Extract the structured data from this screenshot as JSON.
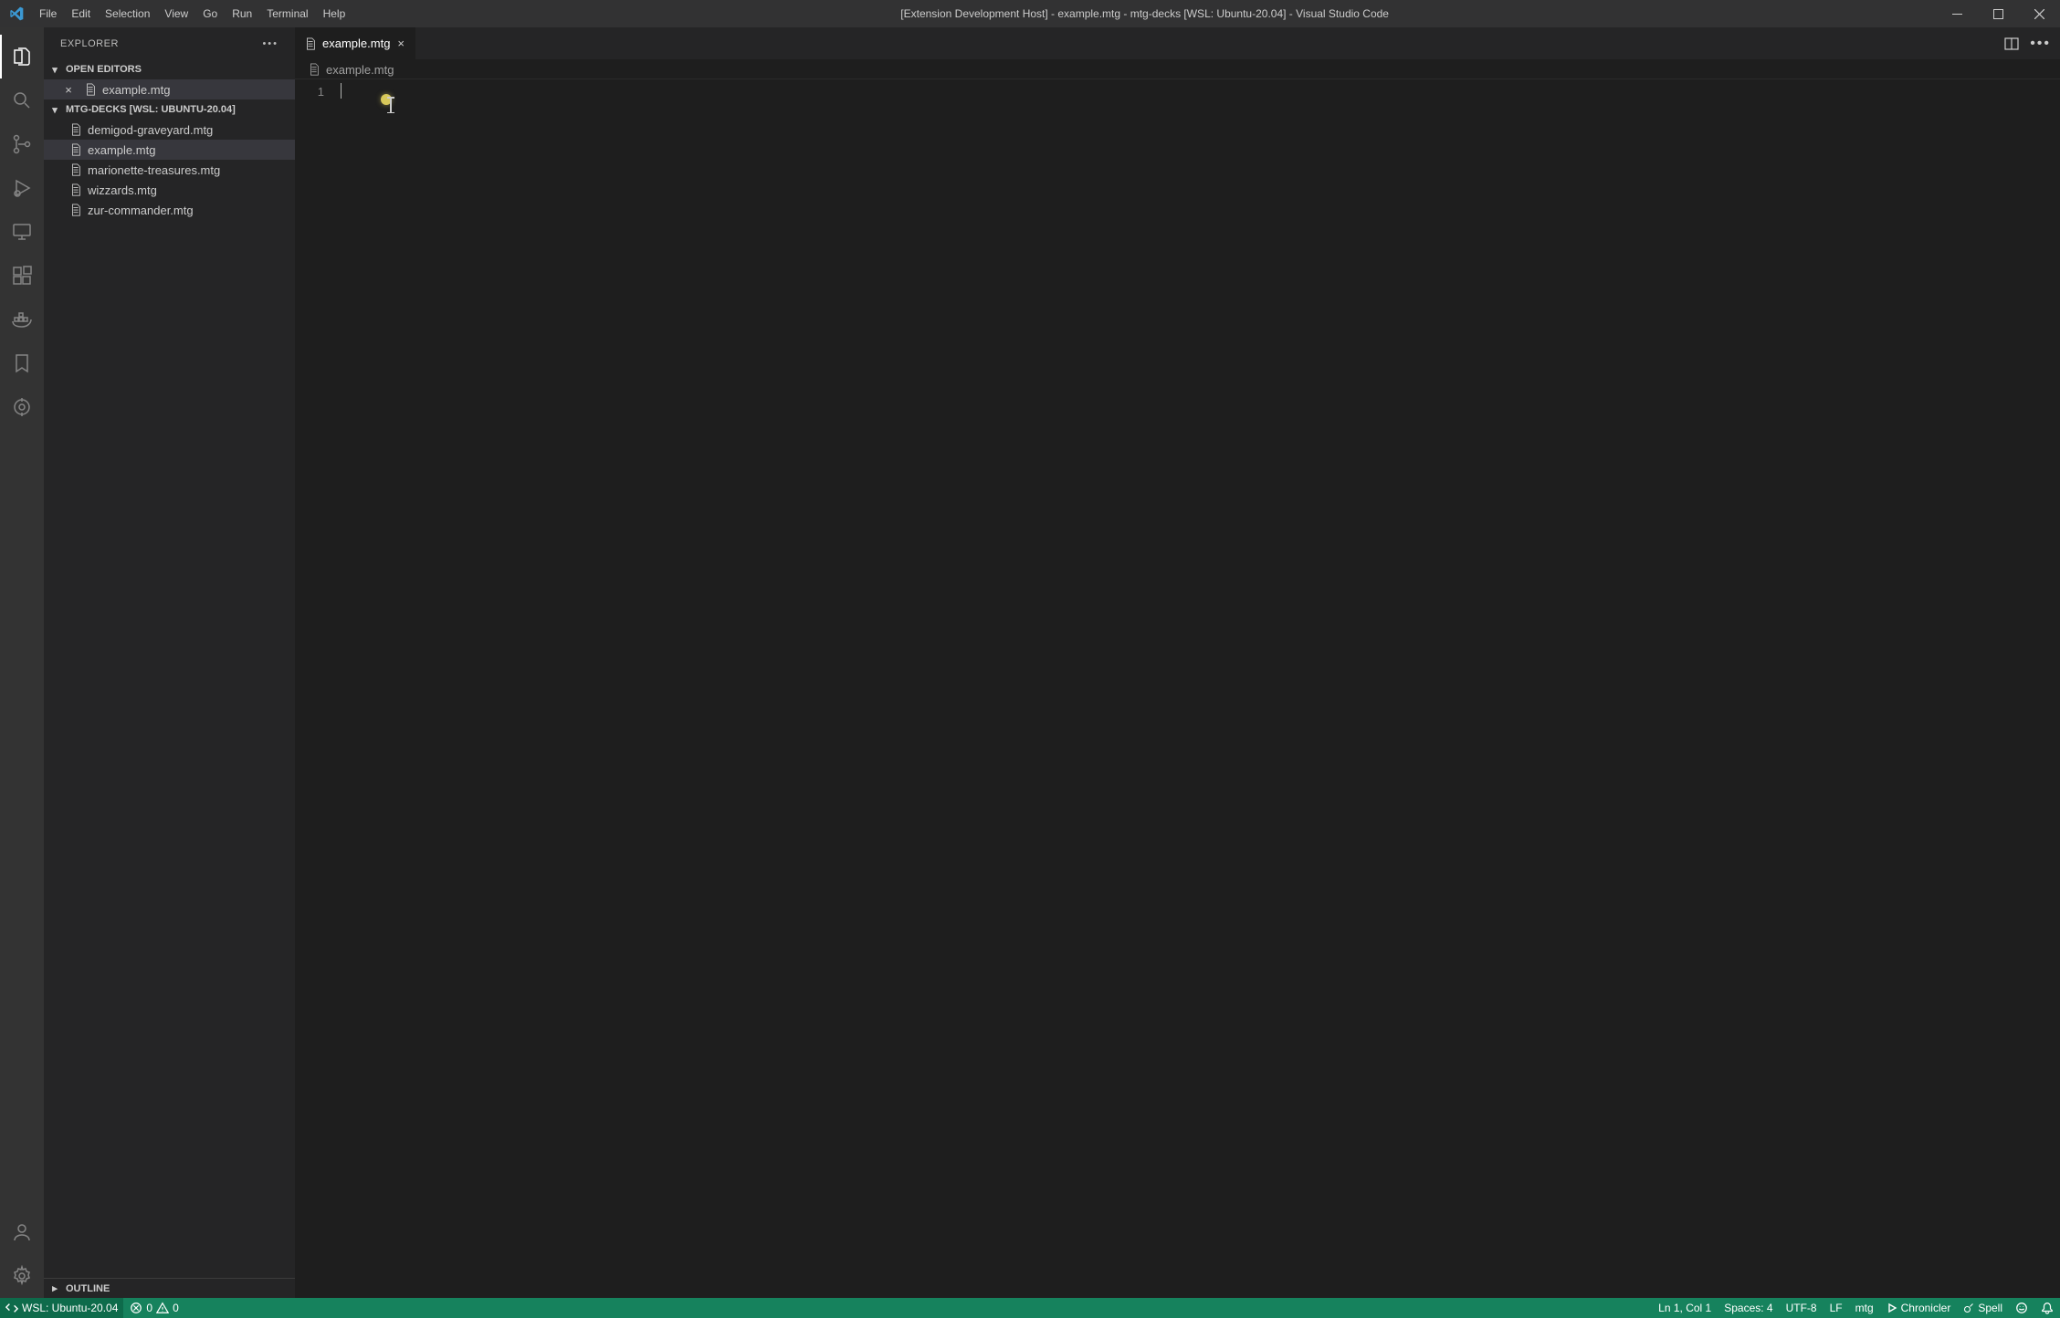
{
  "titlebar": {
    "menus": [
      "File",
      "Edit",
      "Selection",
      "View",
      "Go",
      "Run",
      "Terminal",
      "Help"
    ],
    "title": "[Extension Development Host] - example.mtg - mtg-decks [WSL: Ubuntu-20.04] - Visual Studio Code"
  },
  "sidebar": {
    "title": "EXPLORER",
    "sections": {
      "open_editors": {
        "label": "OPEN EDITORS",
        "items": [
          "example.mtg"
        ]
      },
      "folder": {
        "label": "MTG-DECKS [WSL: UBUNTU-20.04]",
        "items": [
          "demigod-graveyard.mtg",
          "example.mtg",
          "marionette-treasures.mtg",
          "wizzards.mtg",
          "zur-commander.mtg"
        ],
        "selected_index": 1
      },
      "outline": {
        "label": "OUTLINE"
      }
    }
  },
  "editor": {
    "tab": {
      "filename": "example.mtg"
    },
    "breadcrumb": "example.mtg",
    "line_numbers": [
      "1"
    ]
  },
  "statusbar": {
    "remote": "WSL: Ubuntu-20.04",
    "errors": "0",
    "warnings": "0",
    "cursor": "Ln 1, Col 1",
    "spaces": "Spaces: 4",
    "encoding": "UTF-8",
    "eol": "LF",
    "language": "mtg",
    "chronicler": "Chronicler",
    "spell": "Spell"
  }
}
